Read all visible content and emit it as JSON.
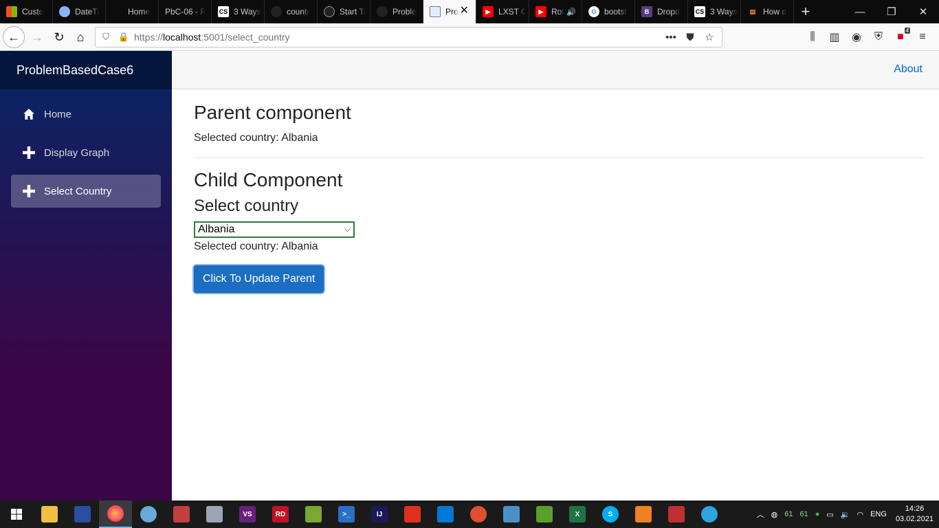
{
  "browser": {
    "tabs": [
      {
        "label": "Custo",
        "icon": "windows-icon",
        "color": "#f25022",
        "active": false
      },
      {
        "label": "DateTi",
        "icon": "sphere-icon",
        "color": "#8ab4f8",
        "active": false
      },
      {
        "label": "Home",
        "icon": "blank-icon",
        "color": "#0c0c0d",
        "active": false
      },
      {
        "label": "PbC-06 - R",
        "icon": "blank-icon",
        "color": "#0c0c0d",
        "active": false
      },
      {
        "label": "3 Ways",
        "icon": "cs-icon",
        "color": "#ffffff",
        "active": false
      },
      {
        "label": "countr",
        "icon": "github-icon",
        "color": "#333333",
        "active": false
      },
      {
        "label": "Start Ti",
        "icon": "github-icon",
        "color": "#333333",
        "active": false
      },
      {
        "label": "Proble",
        "icon": "github-icon",
        "color": "#333333",
        "active": false
      },
      {
        "label": "Pro",
        "icon": "page-icon",
        "color": "#5b7fb5",
        "active": true
      },
      {
        "label": "LXST C",
        "icon": "youtube-icon",
        "color": "#ff0000",
        "active": false
      },
      {
        "label": "Rot",
        "icon": "youtube-icon",
        "color": "#ff0000",
        "active": false
      },
      {
        "label": "bootst",
        "icon": "google-icon",
        "color": "#4285f4",
        "active": false
      },
      {
        "label": "Dropd",
        "icon": "bootstrap-icon",
        "color": "#563d7c",
        "active": false
      },
      {
        "label": "3 Ways",
        "icon": "cs-icon",
        "color": "#ffffff",
        "active": false
      },
      {
        "label": "How d",
        "icon": "stackoverflow-icon",
        "color": "#f48024",
        "active": false
      }
    ],
    "url_prefix": "https://",
    "url_host": "localhost",
    "url_path": ":5001/select_country",
    "extension_badge": "4"
  },
  "sidebar": {
    "brand": "ProblemBasedCase6",
    "items": [
      {
        "label": "Home",
        "icon": "home-icon"
      },
      {
        "label": "Display Graph",
        "icon": "plus-icon"
      },
      {
        "label": "Select Country",
        "icon": "plus-icon"
      }
    ]
  },
  "topbar": {
    "about": "About"
  },
  "main": {
    "parent_title": "Parent component",
    "parent_selected": "Selected country: Albania",
    "child_title": "Child Component",
    "child_subtitle": "Select country",
    "select_value": "Albania",
    "child_selected": "Selected country: Albania",
    "update_button": "Click To Update Parent"
  },
  "taskbar": {
    "language": "ENG",
    "tray_num_1": "61",
    "tray_num_2": "61",
    "time": "14:26",
    "date": "03.02.2021"
  }
}
